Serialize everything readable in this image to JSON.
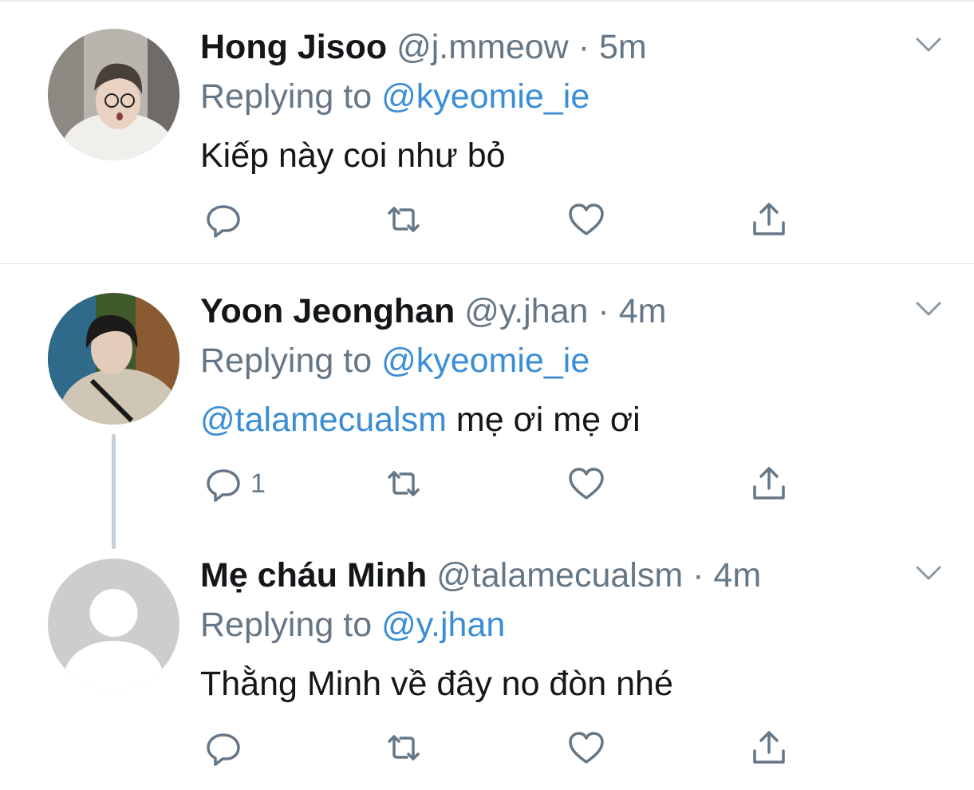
{
  "tweets": [
    {
      "name": "Hong Jisoo",
      "handle": "@j.mmeow",
      "dot": "·",
      "time": "5m",
      "replying_prefix": "Replying to ",
      "replying_to": "@kyeomie_ie",
      "text": "Kiếp này coi như bỏ",
      "mention_in_text": "",
      "reply_count": ""
    },
    {
      "name": "Yoon Jeonghan",
      "handle": "@y.jhan",
      "dot": "·",
      "time": "4m",
      "replying_prefix": "Replying to ",
      "replying_to": "@kyeomie_ie",
      "mention_in_text": "@talamecualsm",
      "text": " mẹ ơi mẹ ơi",
      "reply_count": "1"
    },
    {
      "name": "Mẹ cháu Minh",
      "handle": "@talamecualsm",
      "dot": "·",
      "time": "4m",
      "replying_prefix": "Replying to ",
      "replying_to": "@y.jhan",
      "text": "Thằng Minh về đây no đòn nhé",
      "mention_in_text": "",
      "reply_count": ""
    }
  ],
  "colors": {
    "link": "#3b8ed6",
    "secondary": "#657786",
    "icon": "#657786",
    "thread_line": "#c4cfd6"
  },
  "icons": [
    "reply-icon",
    "retweet-icon",
    "like-icon",
    "share-icon",
    "chevron-down-icon"
  ]
}
